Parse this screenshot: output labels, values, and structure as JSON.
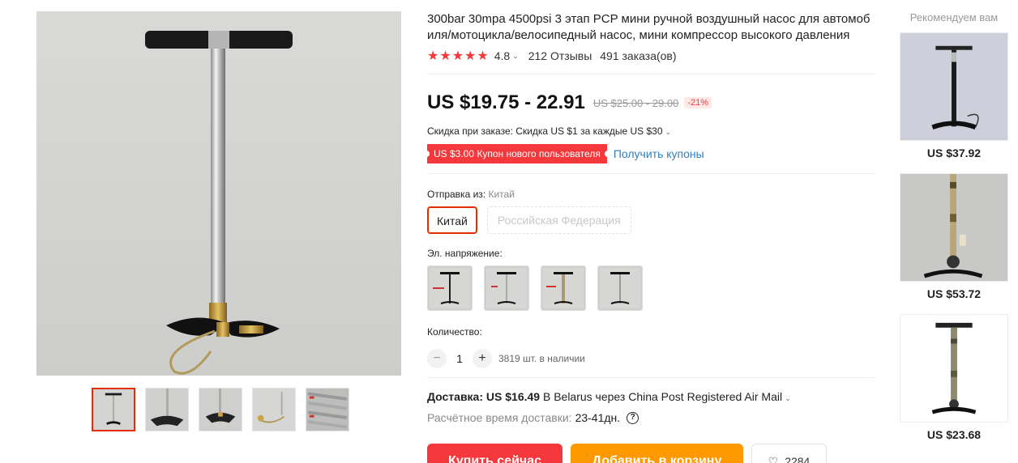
{
  "product": {
    "title": "300bar 30mpa 4500psi 3 этап PCP мини ручной воздушный насос для автомобиля/мотоцикла/велосипедный насос, мини компрессор высокого давления",
    "stars": "★★★★★",
    "rating": "4.8",
    "reviews": "212 Отзывы",
    "orders": "491 заказа(ов)"
  },
  "price": {
    "current": "US $19.75 - 22.91",
    "original": "US $25.00 - 29.00",
    "discount": "-21%"
  },
  "promo": {
    "order_discount": "Скидка при заказе: Скидка US $1 за каждые US $30",
    "coupon_badge": "US $3.00 Купон нового пользователя",
    "coupon_link": "Получить купоны"
  },
  "shipping_from": {
    "label": "Отправка из:",
    "selected": "Китай",
    "options": [
      "Китай",
      "Российская Федерация"
    ]
  },
  "voltage": {
    "label": "Эл. напряжение:"
  },
  "quantity": {
    "label": "Количество:",
    "value": "1",
    "minus": "−",
    "plus": "+",
    "stock": "3819 шт. в наличии"
  },
  "delivery": {
    "label": "Доставка:",
    "price": "US $16.49",
    "text": "В Belarus через China Post Registered Air Mail",
    "time_label": "Расчётное время доставки:",
    "time_value": "23-41дн.",
    "help": "?"
  },
  "actions": {
    "buy": "Купить сейчас",
    "cart": "Добавить в корзину",
    "wishlist_count": "2284"
  },
  "recommended": {
    "title": "Рекомендуем вам",
    "items": [
      {
        "price": "US $37.92"
      },
      {
        "price": "US $53.72"
      },
      {
        "price": "US $23.68"
      }
    ]
  },
  "colors": {
    "accent_red": "#f5383c",
    "accent_orange": "#ff9900",
    "link_blue": "#2e7ebd",
    "selected_border": "#e62e04"
  }
}
